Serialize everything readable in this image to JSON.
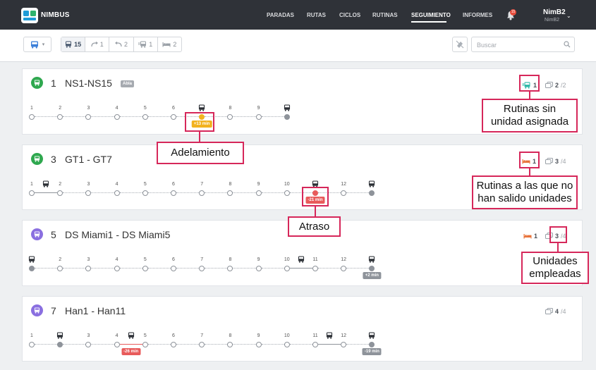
{
  "navbar": {
    "logo_text": "NIMBUS",
    "items": [
      {
        "label": "PARADAS",
        "active": false
      },
      {
        "label": "RUTAS",
        "active": false
      },
      {
        "label": "CICLOS",
        "active": false
      },
      {
        "label": "RUTINAS",
        "active": false
      },
      {
        "label": "SEGUIMIENTO",
        "active": true
      },
      {
        "label": "INFORMES",
        "active": false
      }
    ],
    "notification_count": "15",
    "user_name": "NimB2",
    "user_sub": "NimB2"
  },
  "toolbar": {
    "filters": [
      {
        "icon": "bus-icon",
        "count": "15",
        "active": true
      },
      {
        "icon": "early-arrow-icon",
        "count": "1",
        "active": false
      },
      {
        "icon": "late-arrow-icon",
        "count": "2",
        "active": false
      },
      {
        "icon": "no-unit-bus-icon",
        "count": "1",
        "active": false
      },
      {
        "icon": "bed-icon",
        "count": "2",
        "active": false
      }
    ],
    "search_placeholder": "Buscar"
  },
  "routes": [
    {
      "number": "1",
      "name": "NS1-NS15",
      "badge": "Abla",
      "circle_color": "#2fa84f",
      "stops": [
        "1",
        "2",
        "3",
        "4",
        "5",
        "6",
        "",
        "8",
        "9"
      ],
      "stat_a": {
        "icon": "no-unit-bus-icon",
        "value": "1",
        "color": "#26b5a4"
      },
      "stat_b": {
        "value": "2",
        "total": "/2"
      },
      "delay_label": "+13 min"
    },
    {
      "number": "3",
      "name": "GT1 - GT7",
      "badge": "",
      "circle_color": "#2fa84f",
      "stops": [
        "1",
        "2",
        "3",
        "4",
        "5",
        "6",
        "7",
        "8",
        "9",
        "10",
        "",
        "12",
        ""
      ],
      "stat_a": {
        "icon": "bed-icon",
        "value": "1",
        "color": "#e8733a"
      },
      "stat_b": {
        "value": "3",
        "total": "/4"
      },
      "delay_label": "-21 min"
    },
    {
      "number": "5",
      "name": "DS Miami1 - DS Miami5",
      "badge": "",
      "circle_color": "#8a6fe0",
      "stops": [
        "",
        "2",
        "3",
        "4",
        "5",
        "6",
        "7",
        "8",
        "9",
        "10",
        "11",
        "12",
        ""
      ],
      "stat_a": {
        "icon": "bed-icon",
        "value": "1",
        "color": "#e8733a"
      },
      "stat_b": {
        "value": "3",
        "total": "/4"
      },
      "delay_label": "+2 min"
    },
    {
      "number": "7",
      "name": "Han1 - Han11",
      "badge": "",
      "circle_color": "#8a6fe0",
      "stops": [
        "1",
        "",
        "3",
        "4",
        "5",
        "6",
        "7",
        "8",
        "9",
        "10",
        "11",
        "12",
        ""
      ],
      "stat_b": {
        "value": "4",
        "total": "/4"
      },
      "delay_label_1": "-26 min",
      "delay_label_2": "-19 min"
    }
  ],
  "annotations": {
    "unassigned": [
      "Rutinas sin",
      "unidad asignada"
    ],
    "early": "Adelamiento",
    "not_departed": [
      "Rutinas a las que no",
      "han salido unidades"
    ],
    "late": "Atraso",
    "units_used": [
      "Unidades",
      "empleadas"
    ]
  }
}
